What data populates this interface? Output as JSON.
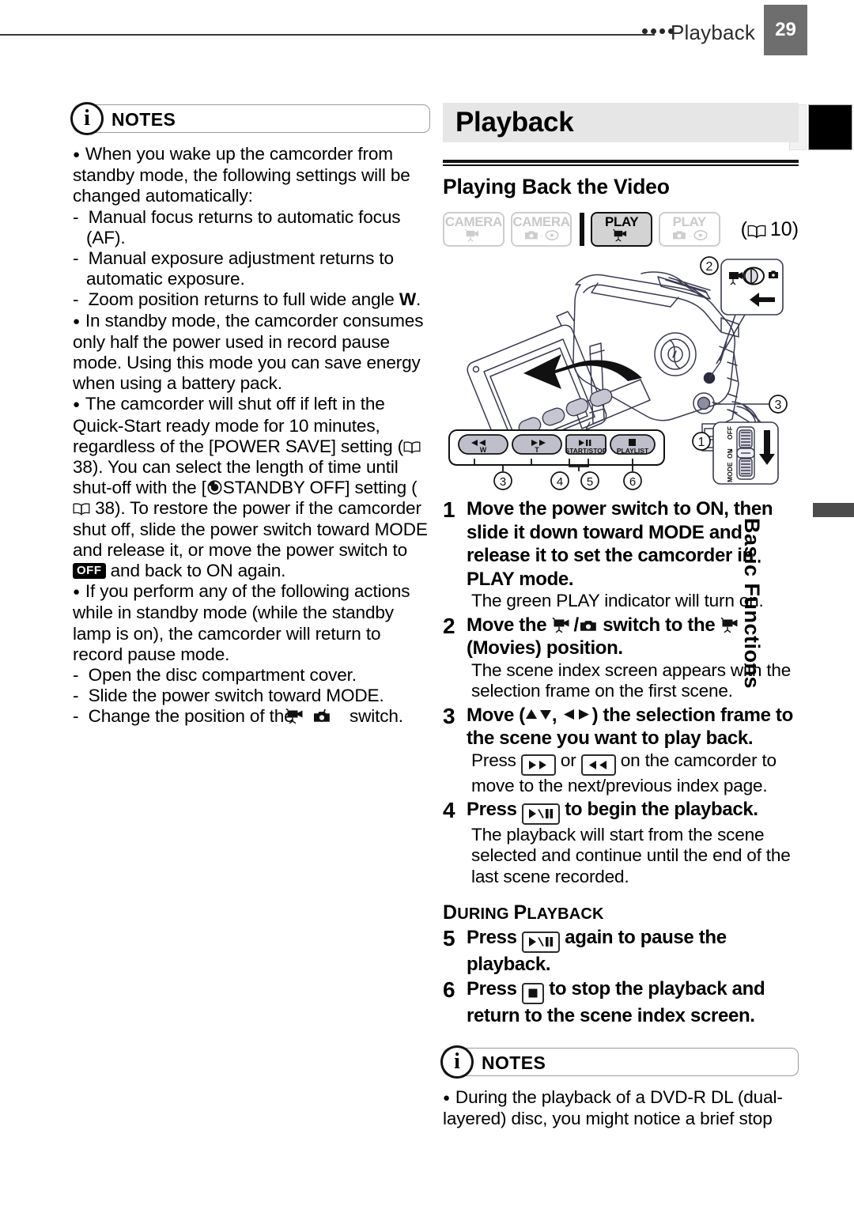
{
  "header": {
    "chapter": "Playback",
    "page_number": "29",
    "dots": 4
  },
  "side_tab": {
    "label": "Basic Functions"
  },
  "left_column": {
    "notes": {
      "icon": "info-circle-icon",
      "label": "NOTES",
      "blocks": [
        {
          "type": "bullet",
          "text": "When you wake up the camcorder from standby mode, the following settings will be changed automatically:"
        },
        {
          "type": "dash",
          "text": "Manual focus returns to automatic focus (AF)."
        },
        {
          "type": "dash",
          "text": "Manual exposure adjustment returns to automatic exposure."
        },
        {
          "type": "dash",
          "text": "Zoom position returns to full wide angle W."
        },
        {
          "type": "bullet",
          "text": "In standby mode, the camcorder consumes only half the power used in record pause mode. Using this mode you can save energy when using a battery pack."
        },
        {
          "type": "bullet",
          "text": "The camcorder will shut off if left in the Quick-Start ready mode for 10 minutes, regardless of the [POWER SAVE] setting (☆ 38). You can select the length of time until shut-off with the [◎ STANDBY OFF] setting (☆ 38). To restore the power if the camcorder shut off, slide the power switch toward MODE and release it, or move the power switch to OFF and back to ON again."
        },
        {
          "type": "bullet",
          "text": "If you perform any of the following actions while in standby mode (while the standby lamp is on), the camcorder will return to record pause mode."
        },
        {
          "type": "dash",
          "text": "Open the disc compartment cover."
        },
        {
          "type": "dash",
          "text": "Slide the power switch toward MODE."
        },
        {
          "type": "dash",
          "text": "Change the position of the ☗/▣ switch."
        }
      ],
      "page_refs": [
        "38",
        "38"
      ],
      "off_badge": "OFF",
      "wide_angle_letter": "W"
    }
  },
  "right_column": {
    "section_title": "Playback",
    "subsection_title": "Playing Back the Video",
    "mode_badges": [
      {
        "label": "CAMERA",
        "icons": [
          "movie-camera-icon"
        ],
        "active": false
      },
      {
        "label": "CAMERA",
        "icons": [
          "photo-camera-icon",
          "disc-icon"
        ],
        "active": false
      },
      {
        "label": "PLAY",
        "icons": [
          "movie-camera-icon"
        ],
        "active": true
      },
      {
        "label": "PLAY",
        "icons": [
          "photo-camera-icon",
          "disc-icon"
        ],
        "active": false
      }
    ],
    "mode_reference": "10",
    "diagram": {
      "callouts": [
        "1",
        "2",
        "3",
        "4",
        "5",
        "6"
      ],
      "button_bar": [
        {
          "glyph": "◀◀",
          "sub": "W"
        },
        {
          "glyph": "▶▶",
          "sub": "T"
        },
        {
          "glyph": "▶/‖",
          "sub": "START/STOP"
        },
        {
          "glyph": "■",
          "sub": "PLAYLIST"
        }
      ],
      "power_switch_labels": [
        "OFF",
        "ON",
        "MODE"
      ],
      "mode_switch_icons": [
        "movie-camera-icon",
        "photo-camera-icon"
      ]
    },
    "steps": [
      {
        "number": "1",
        "bold": "Move the power switch to ON, then slide it down toward MODE and release it to set the camcorder in PLAY mode.",
        "detail": "The green PLAY indicator will turn on."
      },
      {
        "number": "2",
        "bold_pre": "Move the ",
        "bold_mid": " switch to the ",
        "bold_post": " (Movies) position.",
        "detail": "The scene index screen appears with the selection frame on the first scene."
      },
      {
        "number": "3",
        "bold_pre": "Move (",
        "bold_post": ") the selection frame to the scene you want to play back.",
        "detail_pre": "Press ",
        "detail_mid": " or ",
        "detail_post": " on the camcorder to move to the next/previous index page."
      },
      {
        "number": "4",
        "bold_pre": "Press ",
        "bold_post": " to begin the playback.",
        "detail": "The playback will start from the scene selected and continue until the end of the last scene recorded."
      },
      {
        "number": "5",
        "bold_pre": "Press ",
        "bold_post": " again to pause the playback."
      },
      {
        "number": "6",
        "bold_pre": "Press ",
        "bold_post": " to stop the playback and return to the scene index screen."
      }
    ],
    "during_playback_label": "During Playback",
    "bottom_notes": {
      "icon": "info-circle-icon",
      "label": "NOTES",
      "text": "During the playback of a DVD-R DL (dual-layered) disc, you might notice a brief stop"
    }
  },
  "colors": {
    "page_number_box": "#6e6e6e",
    "section_band": "#e6e6e6",
    "active_badge_fill": "#d3d3d3",
    "inactive_badge_text": "#c9c9c9",
    "tab_black": "#000000",
    "tab_gray_bar": "#4c4c4c"
  }
}
